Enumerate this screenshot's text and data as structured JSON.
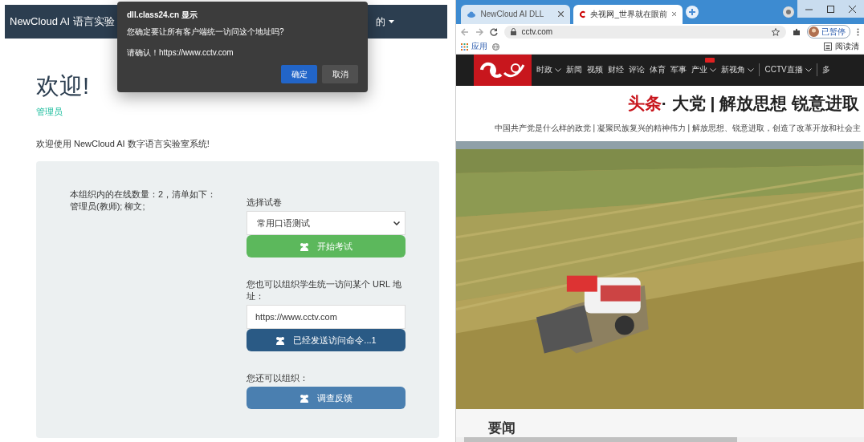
{
  "left_app": {
    "navbar": {
      "title": "NewCloud AI 语言实验",
      "menu": "的"
    },
    "welcome": {
      "heading": "欢迎!",
      "role": "管理员",
      "intro": "欢迎使用 NewCloud AI 数字语言实验室系统!"
    },
    "online": {
      "summary": "本组织内的在线数量：2，清单如下：",
      "users": "管理员(教师); 柳文;"
    },
    "exam": {
      "label": "选择试卷",
      "select_value": "常用口语测试",
      "button": {
        "label": "开始考试",
        "kind": "success"
      }
    },
    "url": {
      "label": "您也可以组织学生统一访问某个 URL 地址：",
      "value": "https://www.cctv.com",
      "button": {
        "label": "已经发送访问命令...1",
        "kind": "primary"
      }
    },
    "survey": {
      "label": "您还可以组织：",
      "button": {
        "label": "调查反馈",
        "kind": "info"
      }
    }
  },
  "dialog": {
    "title": "dll.class24.cn 显示",
    "message": "您确定要让所有客户端统一访问这个地址吗?",
    "confirm_text": "请确认！https://www.cctv.com",
    "buttons": [
      {
        "label": "确定",
        "kind": "primary"
      },
      {
        "label": "取消",
        "kind": "secondary"
      }
    ]
  },
  "browser": {
    "tabs": [
      {
        "title": "NewCloud AI DLL",
        "selected": false
      },
      {
        "title": "央视网_世界就在眼前",
        "selected": true
      }
    ],
    "address": "cctv.com",
    "profile": "已暂停",
    "bookmarks": [
      "应用"
    ],
    "reading_list": "阅读清",
    "site": {
      "nav": [
        {
          "label": "时政",
          "dropdown": true
        },
        {
          "label": "新闻",
          "dropdown": false
        },
        {
          "label": "视频",
          "dropdown": false
        },
        {
          "label": "财经",
          "dropdown": false
        },
        {
          "label": "评论",
          "dropdown": false
        },
        {
          "label": "体育",
          "dropdown": false
        },
        {
          "label": "军事",
          "dropdown": false
        },
        {
          "label": "产业",
          "dropdown": true,
          "badge": true
        },
        {
          "label": "新视角",
          "dropdown": true
        },
        {
          "label": "CCTV直播",
          "dropdown": true,
          "divider": true
        },
        {
          "label": "多",
          "dropdown": false,
          "divider": true
        }
      ],
      "headline_tag": "头条",
      "headline": "· 大党 | 解放思想 锐意进取",
      "subline": "中国共产党是什么样的政党 | 凝聚民族复兴的精神伟力 | 解放思想、锐意进取，创造了改革开放和社会主",
      "section_title": "要闻"
    }
  }
}
